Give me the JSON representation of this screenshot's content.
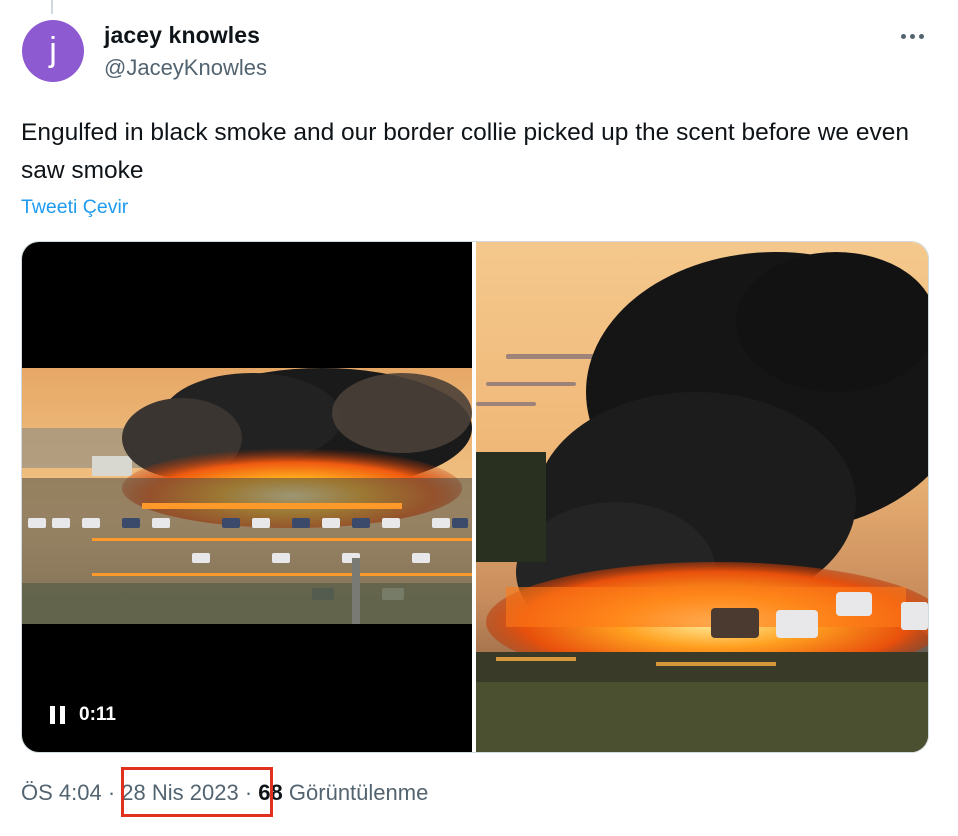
{
  "tweet": {
    "author_name": "jacey knowles",
    "author_handle": "@JaceyKnowles",
    "avatar_letter": "j",
    "avatar_color": "#8e5ad1",
    "more_icon": "more-horizontal-icon",
    "text": "Engulfed in black smoke and our border collie picked up the scent before we even saw smoke",
    "translate_label": "Tweeti Çevir"
  },
  "media": {
    "video_timer": "0:11",
    "video_control_icon": "pause-icon"
  },
  "meta": {
    "time": "ÖS 4:04",
    "separator": "·",
    "date": "28 Nis 2023",
    "views_count": "68",
    "views_label": "Görüntülenme",
    "highlight_color": "#e0301e"
  },
  "colors": {
    "link": "#1d9bf0",
    "secondary_text": "#536471",
    "primary_text": "#0f1419"
  }
}
